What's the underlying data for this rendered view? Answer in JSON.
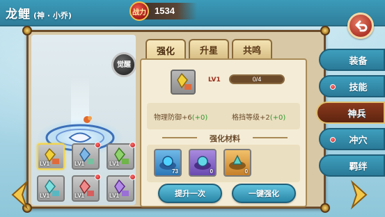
{
  "header": {
    "hero_name": "龙鲤",
    "hero_sub": "(神 · 小乔)",
    "power_label": "战力",
    "power_value": "1534"
  },
  "left": {
    "awaken_label": "觉醒",
    "slots": [
      {
        "level": "LV1",
        "selected": true,
        "dot": false
      },
      {
        "level": "LV1",
        "selected": false,
        "dot": true
      },
      {
        "level": "LV1",
        "selected": false,
        "dot": true
      },
      {
        "level": "LV1",
        "selected": false,
        "dot": false
      },
      {
        "level": "LV1",
        "selected": false,
        "dot": true
      },
      {
        "level": "LV1",
        "selected": false,
        "dot": true
      }
    ]
  },
  "tabs": [
    "强化",
    "升星",
    "共鸣"
  ],
  "detail": {
    "level": "LV1",
    "progress_text": "0/4",
    "progress_fraction": 0,
    "stat1_label": "物理防御+6",
    "stat1_bonus": "(+0)",
    "stat2_label": "格挡等级+2",
    "stat2_bonus": "(+0)",
    "materials_title": "强化材料",
    "materials": [
      {
        "count": "73"
      },
      {
        "count": "0"
      },
      {
        "count": "0"
      }
    ],
    "btn_upgrade_once": "提升一次",
    "btn_one_key": "一键强化"
  },
  "side_menu": [
    {
      "label": "装备",
      "active": false,
      "dot": false
    },
    {
      "label": "技能",
      "active": false,
      "dot": true
    },
    {
      "label": "神兵",
      "active": true,
      "dot": false
    },
    {
      "label": "冲穴",
      "active": false,
      "dot": true
    },
    {
      "label": "羁绊",
      "active": false,
      "dot": false
    }
  ],
  "colors": {
    "accent_blue": "#2b87a8",
    "frame_brown": "#6b4b2b",
    "bonus_green": "#2f9a2f"
  }
}
